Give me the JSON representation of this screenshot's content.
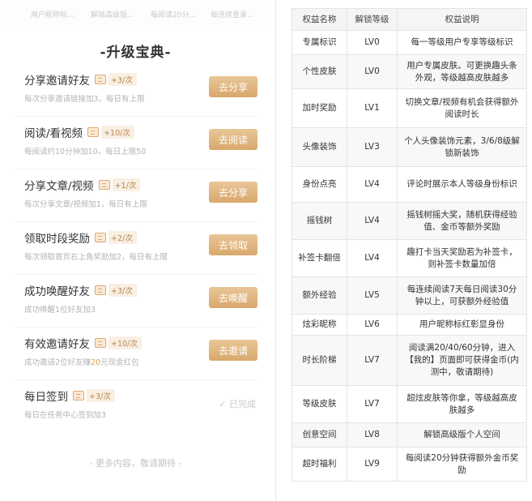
{
  "top_tabs": [
    "用户昵称标...",
    "解锁高级版...",
    "每阅读20分...",
    "每连续登录..."
  ],
  "left_title": "-升级宝典-",
  "tasks": [
    {
      "name": "分享邀请好友",
      "points": "+3/次",
      "desc": "每次分享邀请链接加3，每日有上限",
      "button": "去分享"
    },
    {
      "name": "阅读/看视频",
      "points": "+10/次",
      "desc": "每阅读约10分钟加10，每日上限50",
      "button": "去阅读"
    },
    {
      "name": "分享文章/视频",
      "points": "+1/次",
      "desc": "每次分享文章/视频加1，每日有上限",
      "button": "去分享"
    },
    {
      "name": "领取时段奖励",
      "points": "+2/次",
      "desc": "每次领取首页右上角奖励加2，每日有上限",
      "button": "去领取"
    },
    {
      "name": "成功唤醒好友",
      "points": "+3/次",
      "desc": "成功唤醒1位好友加3",
      "button": "去唤醒"
    },
    {
      "name": "有效邀请好友",
      "points": "+10/次",
      "desc_pre": "成功邀请2位好友赚",
      "desc_hl": "20",
      "desc_post": "元现金红包",
      "button": "去邀请"
    },
    {
      "name": "每日签到",
      "points": "+3/次",
      "desc": "每日在任务中心签到加3",
      "status": "✓ 已完成"
    }
  ],
  "more_text": "- 更多内容，敬请期待 -",
  "table": {
    "headers": [
      "权益名称",
      "解锁等级",
      "权益说明"
    ],
    "rows": [
      {
        "name": "专属标识",
        "level": "LV0",
        "desc": "每一等级用户专享等级标识"
      },
      {
        "name": "个性皮肤",
        "level": "LV0",
        "desc": "用户专属皮肤。可更换趣头条外观，等级越高皮肤越多"
      },
      {
        "name": "加时奖励",
        "level": "LV1",
        "desc": "切换文章/视频有机会获得额外阅读时长"
      },
      {
        "name": "头像装饰",
        "level": "LV3",
        "desc": "个人头像装饰元素，3/6/8级解锁新装饰"
      },
      {
        "name": "身份点亮",
        "level": "LV4",
        "desc": "评论时展示本人等级身份标识"
      },
      {
        "name": "摇钱树",
        "level": "LV4",
        "desc": "摇钱树摇大奖，随机获得经验值、金币等额外奖励"
      },
      {
        "name": "补签卡翻倍",
        "level": "LV4",
        "desc": "趣打卡当天奖励若为补签卡，则补签卡数量加倍"
      },
      {
        "name": "额外经验",
        "level": "LV5",
        "desc": "每连续阅读7天每日阅读30分钟以上，可获额外经验值"
      },
      {
        "name": "炫彩昵称",
        "level": "LV6",
        "desc": "用户昵称标红彰显身份"
      },
      {
        "name": "时长阶梯",
        "level": "LV7",
        "desc": "阅读满20/40/60分钟，进入【我的】页面即可获得金币(内测中，敬请期待)"
      },
      {
        "name": "等级皮肤",
        "level": "LV7",
        "desc": "超炫皮肤等你拿，等级越高皮肤越多"
      },
      {
        "name": "创意空间",
        "level": "LV8",
        "desc": "解锁高级版个人空间"
      },
      {
        "name": "超时福利",
        "level": "LV9",
        "desc": "每阅读20分钟获得额外金币奖励"
      }
    ]
  },
  "colors": {
    "button_gradient_top": "#e9c698",
    "button_gradient_bottom": "#d8a86c",
    "points_text": "#b7864a",
    "highlight": "#e2a253"
  }
}
